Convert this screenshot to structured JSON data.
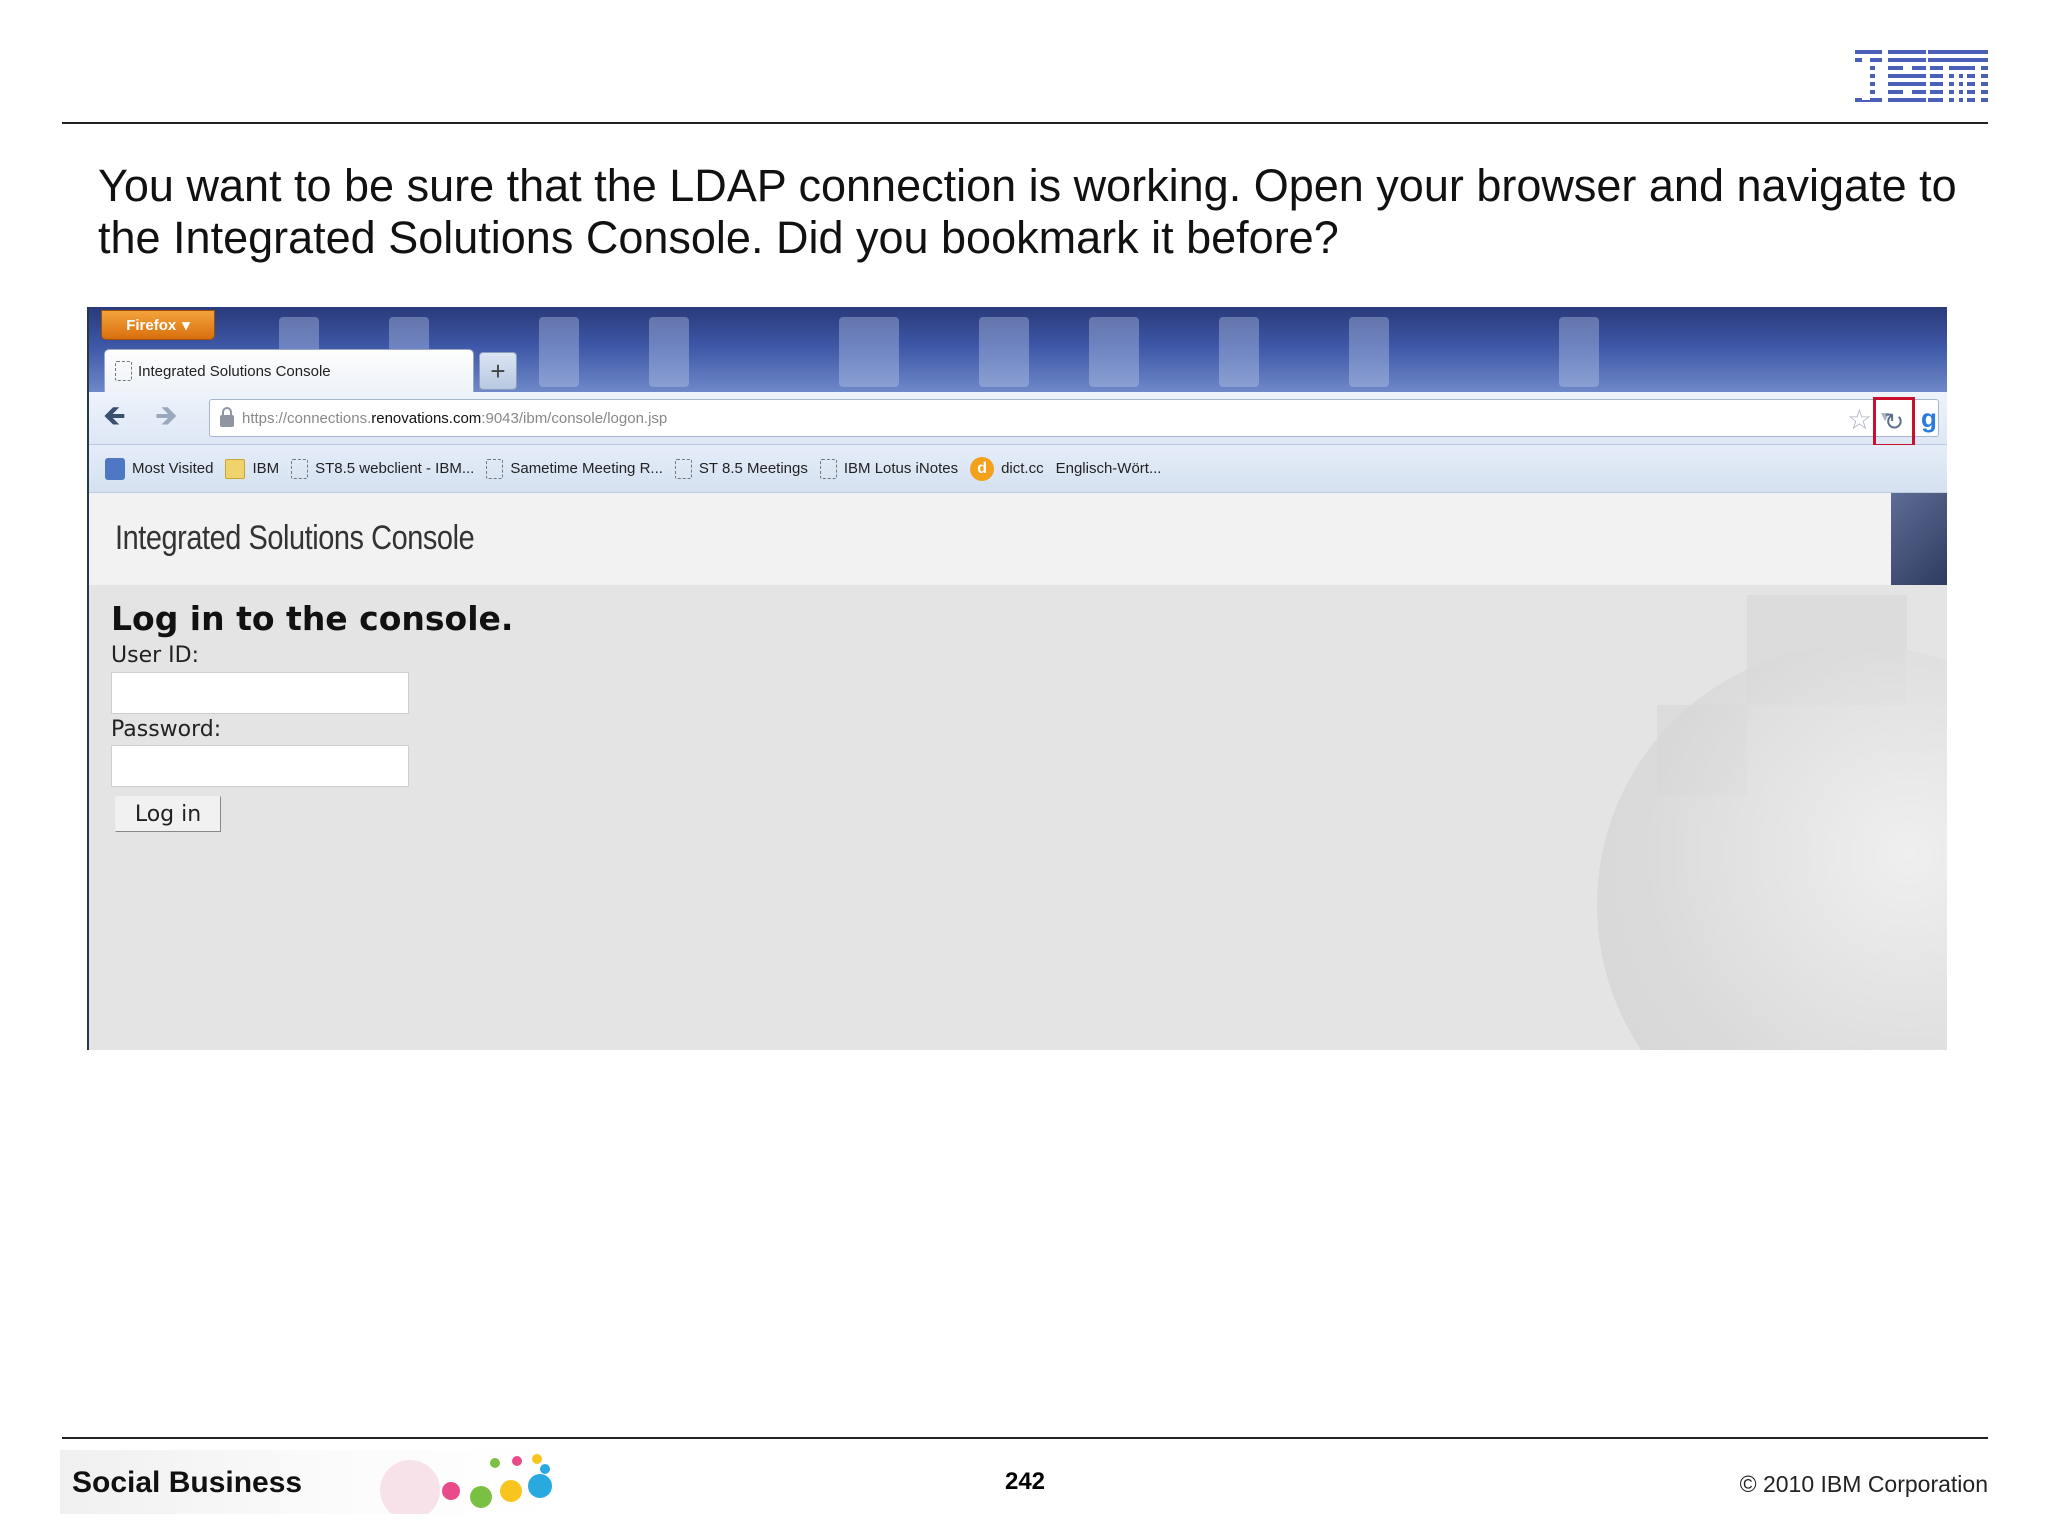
{
  "slide": {
    "logo_text": "IBM",
    "heading": "You want to be sure that the LDAP connection is working. Open your browser and navigate to the Integrated Solutions Console. Did you bookmark it before?",
    "page_number": "242",
    "copyright": "© 2010 IBM Corporation",
    "banner_label": "Social Business"
  },
  "browser": {
    "menu_button": "Firefox",
    "tab_title": "Integrated Solutions Console",
    "new_tab_label": "+",
    "url_prefix": "https://connections.",
    "url_domain": "renovations.com",
    "url_suffix": ":9043/ibm/console/logon.jsp",
    "reload_highlight_color": "#c8102e",
    "bookmarks": [
      {
        "label": "Most Visited",
        "icon": "most-visited-icon"
      },
      {
        "label": "IBM",
        "icon": "folder-icon"
      },
      {
        "label": "ST8.5 webclient - IBM...",
        "icon": "page-icon"
      },
      {
        "label": "Sametime Meeting R...",
        "icon": "page-icon"
      },
      {
        "label": "ST 8.5 Meetings",
        "icon": "page-icon"
      },
      {
        "label": "IBM Lotus iNotes",
        "icon": "page-icon"
      },
      {
        "label": "dict.cc",
        "icon": "dictcc-icon"
      },
      {
        "label": "Englisch-Wört...",
        "icon": "none"
      }
    ]
  },
  "console": {
    "header_title": "Integrated Solutions Console",
    "login_title": "Log in to the console.",
    "user_label": "User ID:",
    "user_value": "",
    "password_label": "Password:",
    "password_value": "",
    "login_button": "Log in"
  }
}
